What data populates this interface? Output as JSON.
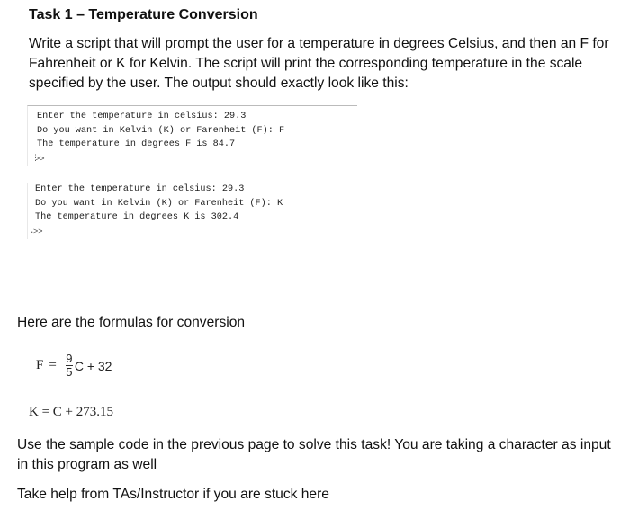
{
  "task": {
    "title": "Task 1 – Temperature Conversion",
    "intro": "Write a script that will prompt the user for a temperature in degrees Celsius, and then an F for Fahrenheit or K for Kelvin. The script will print the corresponding temperature in the scale specified by the user. The output should exactly look like this:"
  },
  "examples": [
    {
      "lines": [
        "Enter the temperature in celsius: 29.3",
        "Do you want in Kelvin (K) or Farenheit (F): F",
        "The temperature in degrees F is 84.7"
      ],
      "prompt": ">>"
    },
    {
      "lines": [
        "Enter the temperature in celsius: 29.3",
        "Do you want in Kelvin (K) or Farenheit (F): K",
        "The temperature in degrees K is 302.4"
      ],
      "prompt": ">>"
    }
  ],
  "formulas": {
    "heading": "Here are the formulas for conversion",
    "fahrenheit": {
      "lhs": "F",
      "eq": "=",
      "numerator": "9",
      "denominator": "5",
      "rest": "C + 32"
    },
    "kelvin": "K = C + 273.15"
  },
  "notes": [
    "Use the sample code in the previous page to solve this task! You are taking a character as input in this program as well",
    "Take help from TAs/Instructor if you are stuck here"
  ]
}
